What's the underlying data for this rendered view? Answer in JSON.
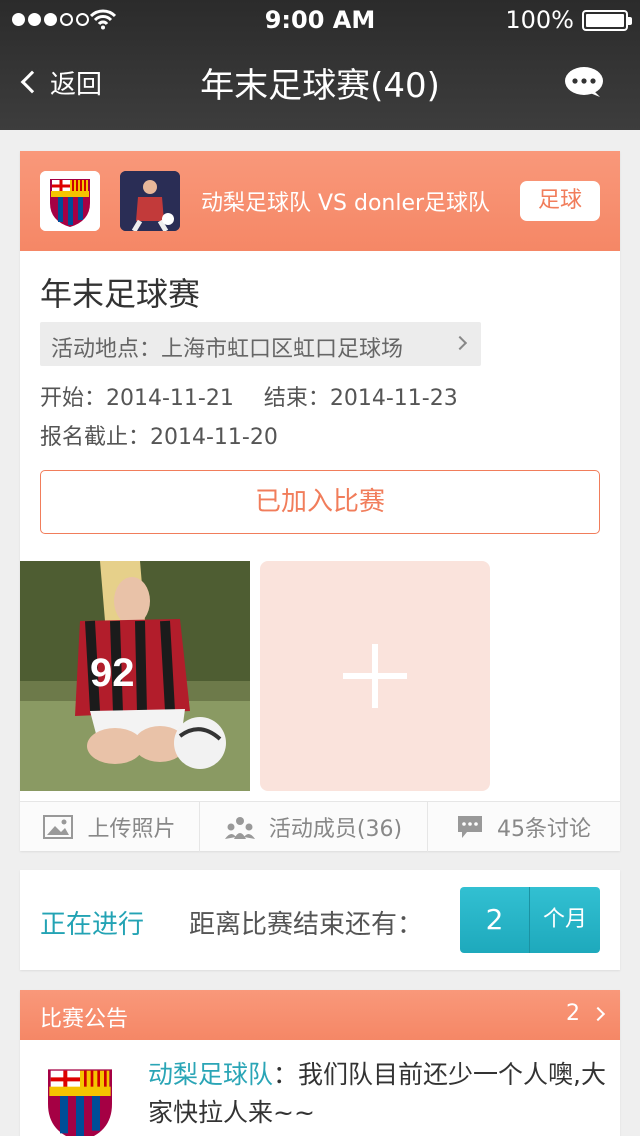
{
  "status_bar": {
    "time": "9:00 AM",
    "battery": "100%"
  },
  "nav": {
    "back_label": "返回",
    "title": "年末足球赛(40)"
  },
  "match": {
    "teams": "动梨足球队 VS donler足球队",
    "sport_tag": "足球",
    "title": "年末足球赛",
    "location": "活动地点：上海市虹口区虹口足球场",
    "start": "开始：2014-11-21",
    "end": "结束：2014-11-23",
    "deadline": "报名截止：2014-11-20",
    "join_label": "已加入比赛"
  },
  "actions": [
    {
      "label": "上传照片",
      "icon": "picture-icon"
    },
    {
      "label": "活动成员(36)",
      "icon": "members-icon"
    },
    {
      "label": "45条讨论",
      "icon": "chat-icon"
    }
  ],
  "progress": {
    "status": "正在进行",
    "label": "距离比赛结束还有：",
    "value": "2",
    "unit": "个月"
  },
  "notice": {
    "title": "比赛公告",
    "count": "2",
    "author": "动梨足球队",
    "text": "：我们队目前还少一个人噢,大家快拉人来~~"
  },
  "colors": {
    "accent": "#f58766",
    "teal": "#23a3b4",
    "bar": "#333333"
  }
}
